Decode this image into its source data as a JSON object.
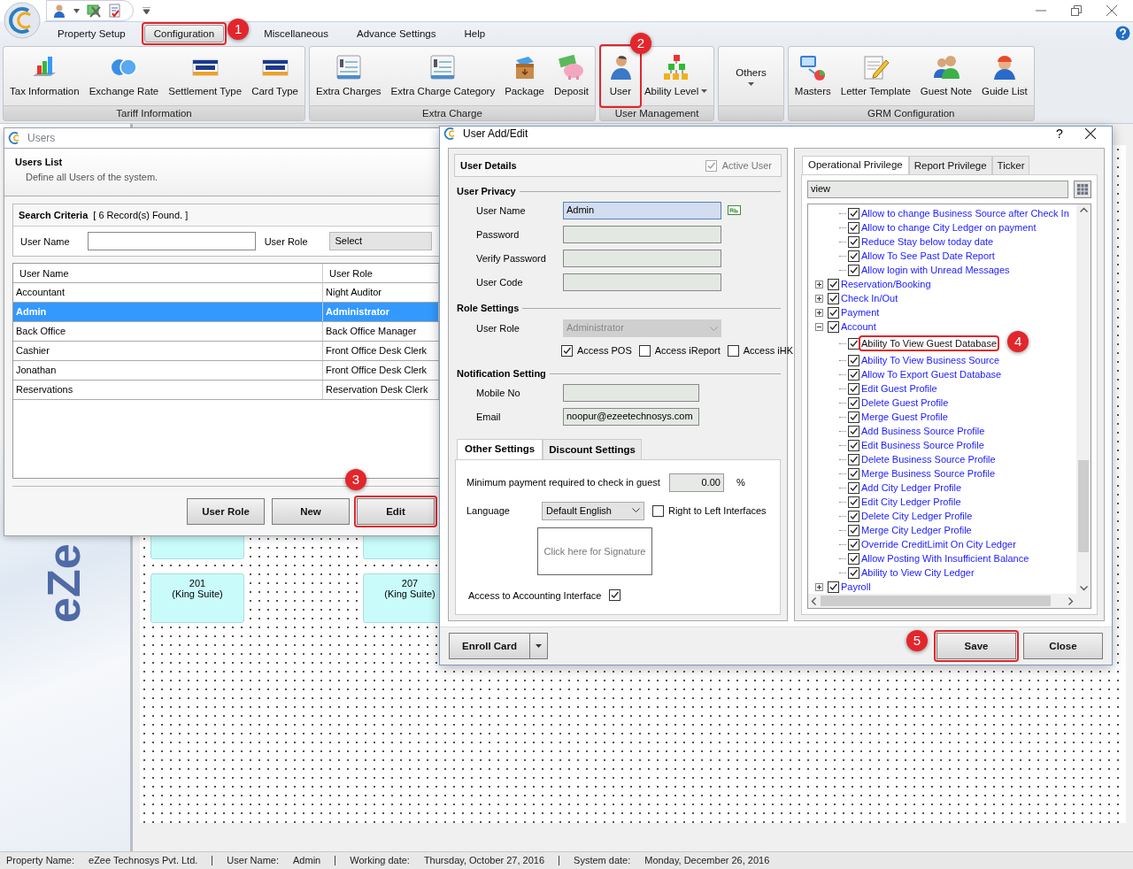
{
  "menu_tabs": [
    {
      "label": "Property Setup",
      "selected": false
    },
    {
      "label": "Configuration",
      "selected": true,
      "marker": "1"
    },
    {
      "label": "Miscellaneous",
      "selected": false
    },
    {
      "label": "Advance Settings",
      "selected": false
    },
    {
      "label": "Help",
      "selected": false
    }
  ],
  "ribbon": {
    "groups": [
      {
        "title": "Tariff Information",
        "items": [
          {
            "label": "Tax Information",
            "kind": "icon",
            "dropdown": false
          },
          {
            "label": "Exchange Rate",
            "kind": "icon",
            "dropdown": false
          },
          {
            "label": "Settlement Type",
            "kind": "icon",
            "dropdown": false
          },
          {
            "label": "Card Type",
            "kind": "icon",
            "dropdown": false
          }
        ]
      },
      {
        "title": "Extra Charge",
        "items": [
          {
            "label": "Extra Charges",
            "kind": "icon",
            "dropdown": false
          },
          {
            "label": "Extra Charge Category",
            "kind": "icon",
            "dropdown": false
          },
          {
            "label": "Package",
            "kind": "icon",
            "dropdown": false
          },
          {
            "label": "Deposit",
            "kind": "icon",
            "dropdown": false
          }
        ]
      },
      {
        "title": "User Management",
        "items": [
          {
            "label": "User",
            "kind": "icon",
            "dropdown": false,
            "marker": "2"
          },
          {
            "label": "Ability Level",
            "kind": "icon",
            "dropdown": true
          }
        ]
      },
      {
        "items": [
          {
            "label": "Others",
            "kind": "menu",
            "dropdown": true
          }
        ]
      },
      {
        "title": "GRM Configuration",
        "items": [
          {
            "label": "Masters",
            "kind": "icon",
            "dropdown": false
          },
          {
            "label": "Letter Template",
            "kind": "icon",
            "dropdown": false
          },
          {
            "label": "Guest Note",
            "kind": "icon",
            "dropdown": false
          },
          {
            "label": "Guide List",
            "kind": "icon",
            "dropdown": false
          }
        ]
      }
    ]
  },
  "desktop": {
    "brand": "eZe",
    "rooms": [
      {
        "number": "201",
        "type": "(King Suite)"
      },
      {
        "number": "207",
        "type": "(King Suite)"
      }
    ]
  },
  "users_window": {
    "title": "Users",
    "heading": "Users List",
    "subtitle": "Define all Users of the system.",
    "search_title": "Search Criteria",
    "record_count": "[ 6 Record(s) Found. ]",
    "name_label": "User Name",
    "role_label": "User Role",
    "role_select": "Select",
    "columns": [
      "User Name",
      "User Role"
    ],
    "rows": [
      {
        "cells": [
          "Accountant",
          "Night Auditor"
        ],
        "selected": false
      },
      {
        "cells": [
          "Admin",
          "Administrator"
        ],
        "selected": true
      },
      {
        "cells": [
          "Back Office",
          "Back Office Manager"
        ],
        "selected": false
      },
      {
        "cells": [
          "Cashier",
          "Front Office Desk Clerk"
        ],
        "selected": false
      },
      {
        "cells": [
          "Jonathan",
          "Front Office Desk Clerk"
        ],
        "selected": false
      },
      {
        "cells": [
          "Reservations",
          "Reservation Desk Clerk"
        ],
        "selected": false
      }
    ],
    "buttons": [
      {
        "label": "User Role"
      },
      {
        "label": "New"
      },
      {
        "label": "Edit",
        "marker": "3"
      }
    ]
  },
  "user_dialog": {
    "title": "User Add/Edit",
    "help_button": "?",
    "details_title": "User Details",
    "active_user": {
      "label": "Active User",
      "checked": true,
      "disabled": true
    },
    "privacy": {
      "title": "User Privacy",
      "fields": [
        {
          "label": "User Name",
          "value": "Admin",
          "focused": true
        },
        {
          "label": "Password",
          "focused": false
        },
        {
          "label": "Verify Password",
          "focused": false
        },
        {
          "label": "User Code",
          "focused": false
        }
      ]
    },
    "role": {
      "title": "Role Settings",
      "label": "User Role",
      "value": "Administrator",
      "disabled": true,
      "access": [
        {
          "label": "Access POS",
          "checked": true
        },
        {
          "label": "Access iReport",
          "checked": false
        },
        {
          "label": "Access iHK",
          "checked": false
        }
      ]
    },
    "notification": {
      "title": "Notification Setting",
      "fields": [
        {
          "label": "Mobile No"
        },
        {
          "label": "Email",
          "value": "noopur@ezeetechnosys.com"
        }
      ]
    },
    "settings_tabs": [
      {
        "label": "Other Settings",
        "selected": true
      },
      {
        "label": "Discount Settings",
        "selected": false
      }
    ],
    "min_payment": {
      "label": "Minimum payment required to check in guest",
      "value": "0.00",
      "unit": "%"
    },
    "language": {
      "label": "Language",
      "value": "Default English"
    },
    "rtl": {
      "label": "Right to Left Interfaces",
      "checked": false
    },
    "signature": {
      "placeholder": "Click here for Signature"
    },
    "accounting": {
      "label": "Access to Accounting Interface",
      "checked": true
    },
    "privilege_tabs": [
      {
        "label": "Operational Privilege",
        "selected": true
      },
      {
        "label": "Report Privilege",
        "selected": false
      },
      {
        "label": "Ticker",
        "selected": false
      }
    ],
    "privilege_search": {
      "value": "view"
    },
    "tree": {
      "partial_children": [
        {
          "label": "Allow to change Business Source after Check In",
          "checked": true,
          "selected": false
        },
        {
          "label": "Allow to change City Ledger on payment",
          "checked": true,
          "selected": false
        },
        {
          "label": "Reduce Stay below today date",
          "checked": true,
          "selected": false
        },
        {
          "label": "Allow To See Past Date Report",
          "checked": true,
          "selected": false
        },
        {
          "label": "Allow login with Unread Messages",
          "checked": true,
          "selected": false
        }
      ],
      "nodes": [
        {
          "label": "Reservation/Booking",
          "checked": true,
          "expanded": false,
          "selected": false
        },
        {
          "label": "Check In/Out",
          "checked": true,
          "expanded": false,
          "selected": false
        },
        {
          "label": "Payment",
          "checked": true,
          "expanded": false,
          "selected": false
        },
        {
          "label": "Account",
          "checked": true,
          "expanded": true,
          "selected": false,
          "children": [
            {
              "label": "Ability To View Guest Database",
              "checked": true,
              "selected": true,
              "marker": "4"
            },
            {
              "label": "Ability To View Business Source",
              "checked": true,
              "selected": false
            },
            {
              "label": "Allow To Export Guest Database",
              "checked": true,
              "selected": false
            },
            {
              "label": "Edit Guest Profile",
              "checked": true,
              "selected": false
            },
            {
              "label": "Delete Guest Profile",
              "checked": true,
              "selected": false
            },
            {
              "label": "Merge Guest Profile",
              "checked": true,
              "selected": false
            },
            {
              "label": "Add Business Source Profile",
              "checked": true,
              "selected": false
            },
            {
              "label": "Edit Business Source Profile",
              "checked": true,
              "selected": false
            },
            {
              "label": "Delete Business Source Profile",
              "checked": true,
              "selected": false
            },
            {
              "label": "Merge Business Source Profile",
              "checked": true,
              "selected": false
            },
            {
              "label": "Add City Ledger Profile",
              "checked": true,
              "selected": false
            },
            {
              "label": "Edit City Ledger Profile",
              "checked": true,
              "selected": false
            },
            {
              "label": "Delete City Ledger Profile",
              "checked": true,
              "selected": false
            },
            {
              "label": "Merge City Ledger Profile",
              "checked": true,
              "selected": false
            },
            {
              "label": "Override CreditLimit On City Ledger",
              "checked": true,
              "selected": false
            },
            {
              "label": "Allow Posting With Insufficient Balance",
              "checked": true,
              "selected": false
            },
            {
              "label": "Ability to View City Ledger",
              "checked": true,
              "selected": false
            }
          ]
        },
        {
          "label": "Payroll",
          "checked": true,
          "expanded": false,
          "selected": false
        }
      ]
    },
    "buttons": [
      {
        "label": "Enroll Card",
        "kind": "split"
      },
      {
        "label": "Save",
        "kind": "plain",
        "marker": "5"
      },
      {
        "label": "Close",
        "kind": "plain"
      }
    ]
  },
  "status_bar": [
    {
      "label": "Property Name:",
      "value": "eZee Technosys Pvt. Ltd."
    },
    {
      "label": "User Name:",
      "value": "Admin"
    },
    {
      "label": "Working date:",
      "value": "Thursday, October 27, 2016"
    },
    {
      "label": "System date:",
      "value": "Monday, December 26, 2016"
    }
  ]
}
